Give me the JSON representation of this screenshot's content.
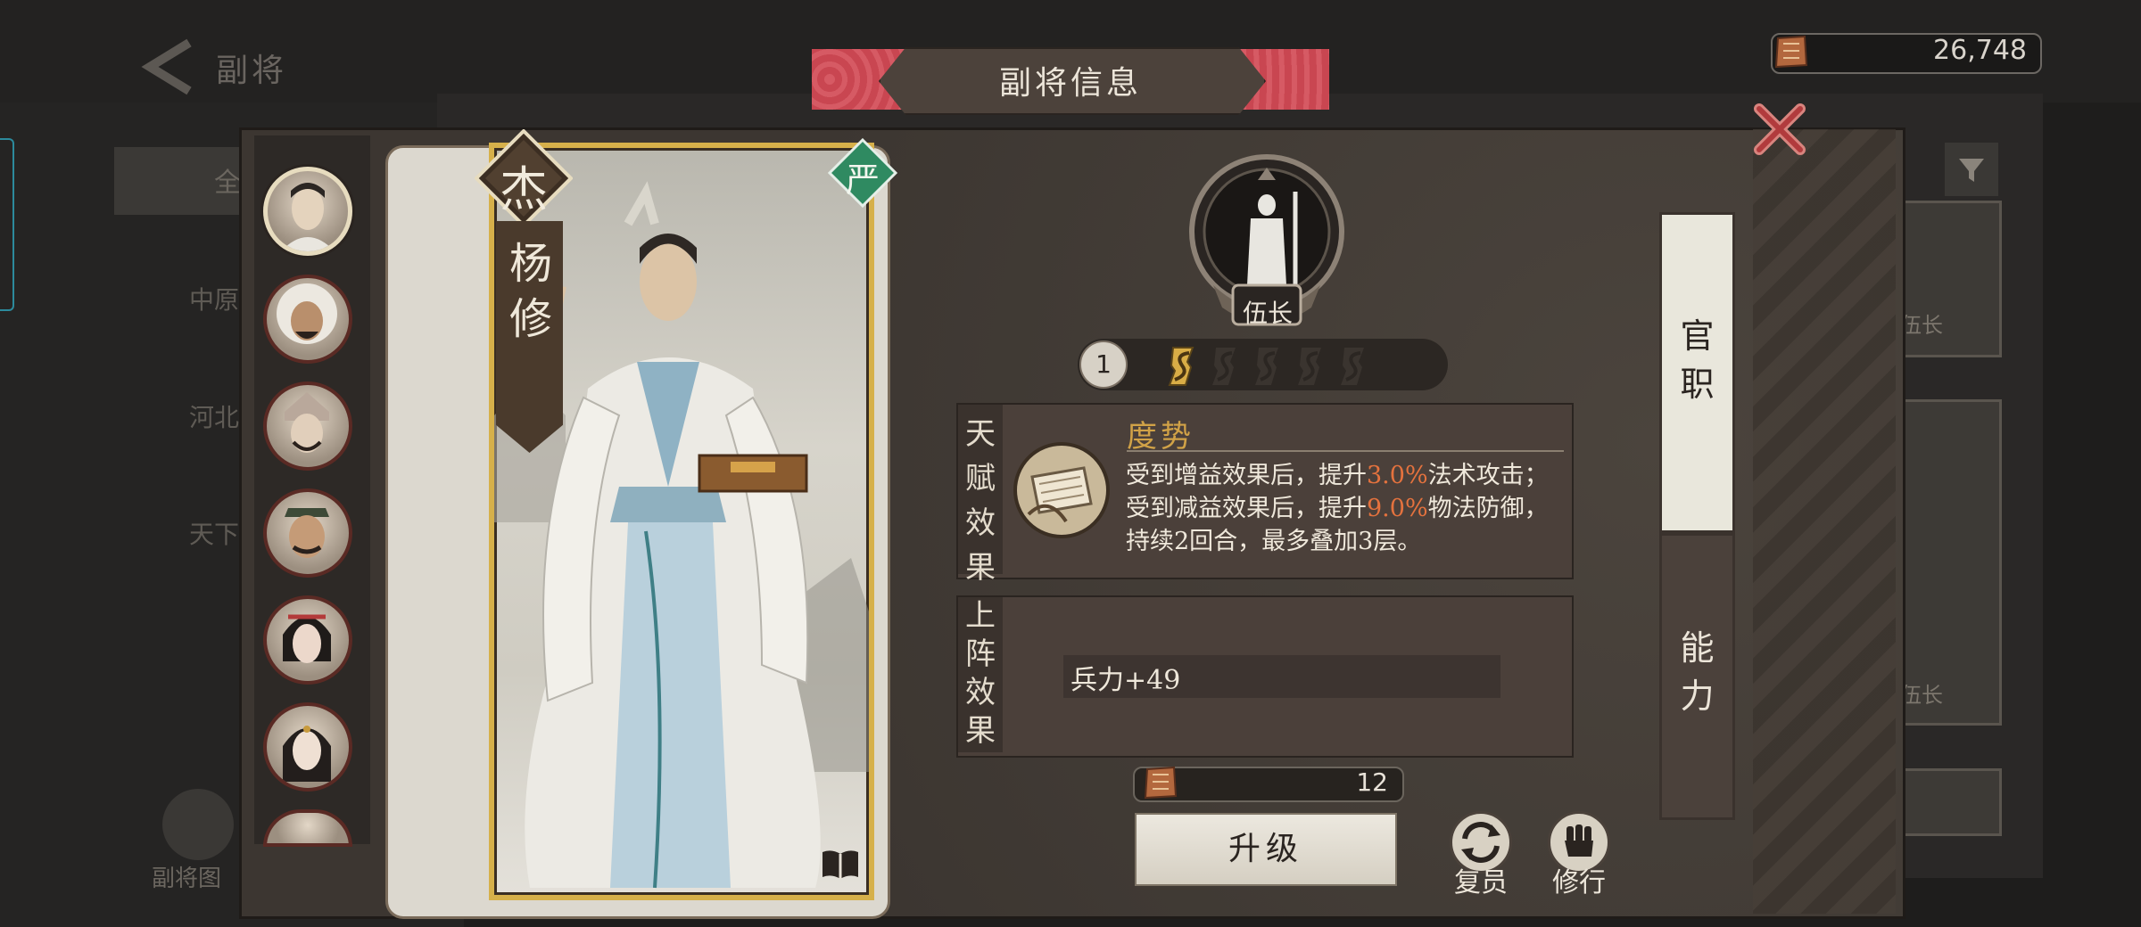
{
  "nav": {
    "back_title": "副将"
  },
  "currency": {
    "icon": "coin-icon",
    "value": "26,748"
  },
  "background": {
    "tab_label": "全",
    "regions": [
      "中原",
      "河北",
      "天下"
    ],
    "library_label": "副将图",
    "card_labels": [
      "伍长",
      "伍长"
    ]
  },
  "modal": {
    "title": "副将信息"
  },
  "hero": {
    "name": "杨修",
    "name_chars": [
      "杨",
      "修"
    ],
    "quality": "杰",
    "camp": "严",
    "rank": "伍长",
    "level": "1",
    "stars_total": 5,
    "stars_filled": 1
  },
  "talent": {
    "section_label": [
      "天",
      "赋",
      "效",
      "果"
    ],
    "name": "度势",
    "desc_part1": "受到增益效果后，提升",
    "desc_val1": "3.0%",
    "desc_part2": "法术攻击；受到减益效果后，提升",
    "desc_val2": "9.0%",
    "desc_part3": "物法防御，持续2回合，最多叠加3层。"
  },
  "battle": {
    "section_label": [
      "上",
      "阵",
      "效",
      "果"
    ],
    "effect": "兵力+49"
  },
  "upgrade": {
    "cost": "12",
    "button_label": "升级"
  },
  "actions": {
    "retire_label": "复员",
    "train_label": "修行"
  },
  "side_tabs": [
    {
      "label": "官职",
      "chars": [
        "官",
        "职"
      ]
    },
    {
      "label": "能力",
      "chars": [
        "能",
        "力"
      ]
    }
  ],
  "colors": {
    "highlight": "#e4723e",
    "talent_name": "#d1a247",
    "header_red": "#c94651",
    "camp_green": "#2f8a61"
  }
}
